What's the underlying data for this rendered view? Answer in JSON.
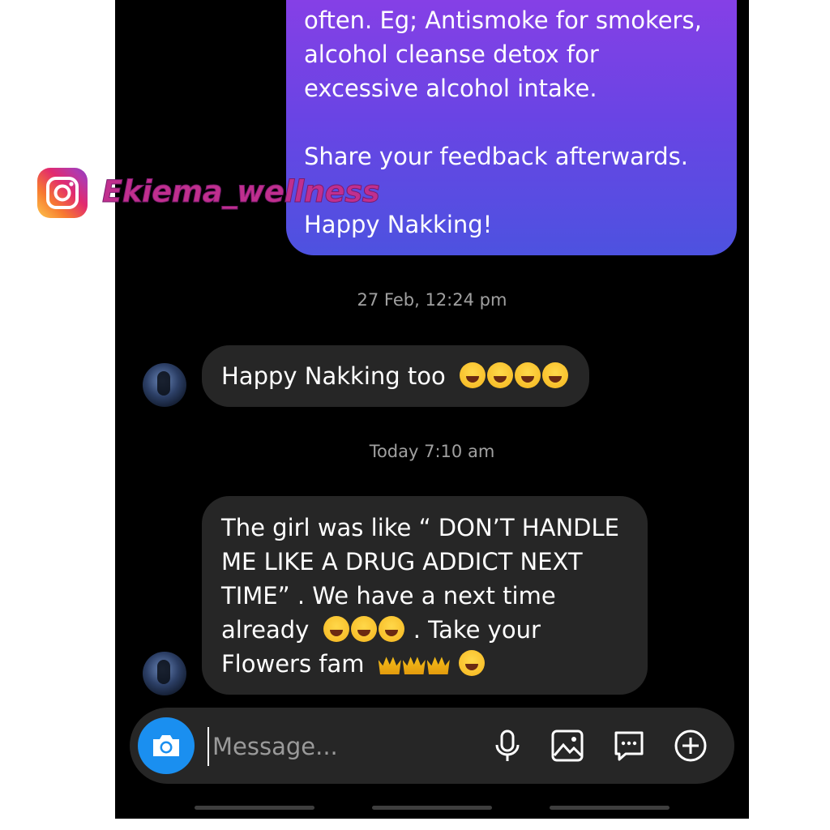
{
  "watermark": {
    "handle": "Ekiema_wellness",
    "brand_icon": "instagram-icon"
  },
  "outgoing_message": {
    "text": "often. Eg; Antismoke for smokers,\nalcohol cleanse detox for\nexcessive alcohol intake.\n\nShare your feedback afterwards.\n\nHappy Nakking!"
  },
  "timestamps": {
    "first": "27 Feb, 12:24 pm",
    "second": "Today 7:10 am"
  },
  "incoming_messages": [
    {
      "text": "Happy Nakking too"
    },
    {
      "line1": "The girl was like “ DON’T HANDLE",
      "line2": "ME LIKE A DRUG ADDICT NEXT",
      "line3": "TIME” . We have a next time",
      "line4": "already",
      "line4_tail": ". Take your",
      "line5": "Flowers fam"
    }
  ],
  "composer": {
    "placeholder": "Message...",
    "icons": [
      "camera-icon",
      "microphone-icon",
      "gallery-icon",
      "sticker-icon",
      "add-icon"
    ]
  },
  "colors": {
    "accent_blue": "#1a8ff0",
    "bubble_gradient_top": "#8b3fe6",
    "bubble_gradient_bottom": "#4d52e0",
    "incoming_bubble": "#262626"
  }
}
